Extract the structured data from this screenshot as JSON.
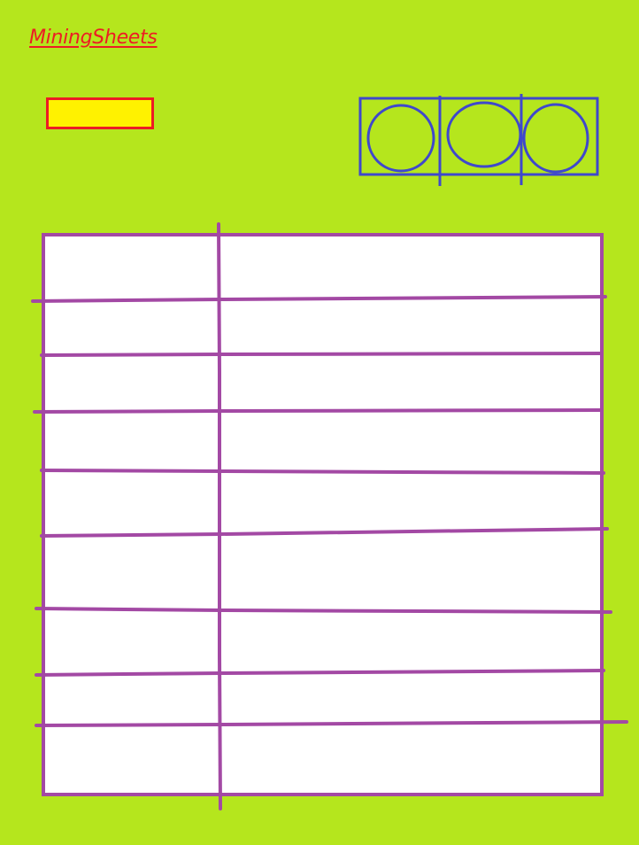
{
  "app": {
    "title": "MiningSheets"
  },
  "toolbar": {
    "primary_button_label": "",
    "icon_group": [
      {
        "name": "circle-icon-1"
      },
      {
        "name": "circle-icon-2"
      },
      {
        "name": "circle-icon-3"
      }
    ]
  },
  "table": {
    "columns": [
      "",
      ""
    ],
    "rows": [
      [
        "",
        ""
      ],
      [
        "",
        ""
      ],
      [
        "",
        ""
      ],
      [
        "",
        ""
      ],
      [
        "",
        ""
      ],
      [
        "",
        ""
      ],
      [
        "",
        ""
      ],
      [
        "",
        ""
      ],
      [
        "",
        ""
      ]
    ]
  },
  "colors": {
    "background": "#b5e61d",
    "title": "#ed1c24",
    "button_fill": "#fff200",
    "button_border": "#ed1c24",
    "icon_group": "#3f48cc",
    "table_lines": "#a349a4",
    "table_fill": "#ffffff"
  }
}
